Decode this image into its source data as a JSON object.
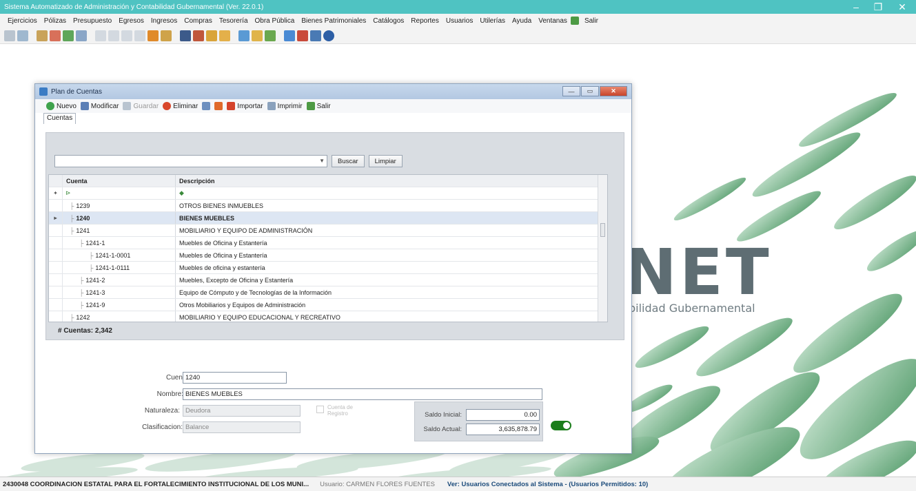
{
  "window": {
    "title": "Sistema Automatizado de Administración y Contabilidad Gubernamental (Ver. 22.0.1)"
  },
  "menu": [
    "Ejercicios",
    "Pólizas",
    "Presupuesto",
    "Egresos",
    "Ingresos",
    "Compras",
    "Tesorería",
    "Obra Pública",
    "Bienes Patrimoniales",
    "Catálogos",
    "Reportes",
    "Usuarios",
    "Utilerías",
    "Ayuda",
    "Ventanas",
    "Salir"
  ],
  "background": {
    "logo_text": "NET",
    "logo_sub": "bilidad Gubernamental"
  },
  "status": {
    "org": "2430048 COORDINACION ESTATAL PARA EL FORTALECIMIENTO INSTITUCIONAL DE LOS MUNI...",
    "user": "Usuario: CARMEN FLORES FUENTES",
    "link": "Ver: Usuarios Conectados al Sistema - (Usuarios Permitidos: 10)"
  },
  "child": {
    "title": "Plan de Cuentas",
    "toolbar": {
      "nuevo": "Nuevo",
      "modificar": "Modificar",
      "guardar": "Guardar",
      "eliminar": "Eliminar",
      "importar": "Importar",
      "imprimir": "Imprimir",
      "salir": "Salir"
    },
    "tab": "Cuentas",
    "search": {
      "value": "",
      "buscar": "Buscar",
      "limpiar": "Limpiar"
    },
    "grid": {
      "col_cuenta": "Cuenta",
      "col_descripcion": "Descripción",
      "rows": [
        {
          "cuenta": "1239",
          "desc": "OTROS BIENES INMUEBLES",
          "indent": 1,
          "marker": ""
        },
        {
          "cuenta": "1240",
          "desc": "BIENES MUEBLES",
          "indent": 1,
          "marker": "▸"
        },
        {
          "cuenta": "1241",
          "desc": "MOBILIARIO Y EQUIPO DE ADMINISTRACIÓN",
          "indent": 1,
          "marker": ""
        },
        {
          "cuenta": "1241-1",
          "desc": "Muebles de Oficina y Estantería",
          "indent": 2,
          "marker": ""
        },
        {
          "cuenta": "1241-1-0001",
          "desc": "Muebles de Oficina y Estantería",
          "indent": 3,
          "marker": ""
        },
        {
          "cuenta": "1241-1-0111",
          "desc": "Muebles de oficina y estantería",
          "indent": 3,
          "marker": ""
        },
        {
          "cuenta": "1241-2",
          "desc": "Muebles, Excepto de Oficina y Estantería",
          "indent": 2,
          "marker": ""
        },
        {
          "cuenta": "1241-3",
          "desc": "Equipo de Cómputo y de Tecnologías de la Información",
          "indent": 2,
          "marker": ""
        },
        {
          "cuenta": "1241-9",
          "desc": "Otros Mobiliarios y Equipos de Administración",
          "indent": 2,
          "marker": ""
        },
        {
          "cuenta": "1242",
          "desc": "MOBILIARIO Y EQUIPO EDUCACIONAL Y RECREATIVO",
          "indent": 1,
          "marker": ""
        }
      ],
      "count_label": "# Cuentas: 2,342"
    },
    "form": {
      "cuenta_label": "Cuenta:",
      "cuenta_value": "1240",
      "nombre_label": "Nombre:",
      "nombre_value": "BIENES MUEBLES",
      "naturaleza_label": "Naturaleza:",
      "naturaleza_value": "Deudora",
      "clasificacion_label": "Clasificacion:",
      "clasificacion_value": "Balance",
      "check_label": "Cuenta de Registro",
      "saldo_inicial_label": "Saldo Inicial:",
      "saldo_inicial_value": "0.00",
      "saldo_actual_label": "Saldo Actual:",
      "saldo_actual_value": "3,635,878.79"
    }
  }
}
